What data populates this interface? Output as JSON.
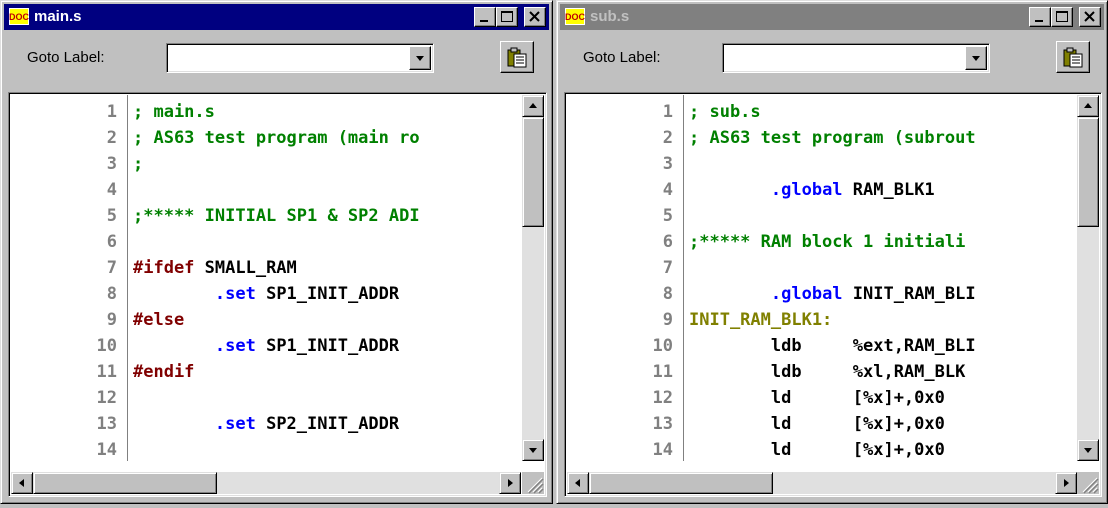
{
  "colors": {
    "comment": "#008000",
    "directive": "#0000ff",
    "preprocessor": "#800000",
    "label": "#808000",
    "normal": "#000000",
    "line_number": "#808080",
    "active_title": "#000080",
    "inactive_title": "#808080"
  },
  "windows": [
    {
      "id": "main",
      "title": "main.s",
      "active": true,
      "icon": "doc-icon",
      "goto_label": "Goto Label:",
      "goto_value": "",
      "lines": [
        {
          "n": "1",
          "text": "; main.s",
          "kind": "comment"
        },
        {
          "n": "2",
          "text": "; AS63 test program (main ro",
          "kind": "comment"
        },
        {
          "n": "3",
          "text": ";",
          "kind": "comment"
        },
        {
          "n": "4",
          "text": "",
          "kind": "normal"
        },
        {
          "n": "5",
          "text": ";***** INITIAL SP1 & SP2 ADI",
          "kind": "comment"
        },
        {
          "n": "6",
          "text": "",
          "kind": "normal"
        },
        {
          "n": "7",
          "segments": [
            {
              "text": "#ifdef",
              "kind": "preprocessor"
            },
            {
              "text": " SMALL_RAM",
              "kind": "normal"
            }
          ]
        },
        {
          "n": "8",
          "segments": [
            {
              "text": "        ",
              "kind": "normal"
            },
            {
              "text": ".set",
              "kind": "directive"
            },
            {
              "text": " SP1_INIT_ADDR",
              "kind": "normal"
            }
          ]
        },
        {
          "n": "9",
          "text": "#else",
          "kind": "preprocessor"
        },
        {
          "n": "10",
          "segments": [
            {
              "text": "        ",
              "kind": "normal"
            },
            {
              "text": ".set",
              "kind": "directive"
            },
            {
              "text": " SP1_INIT_ADDR",
              "kind": "normal"
            }
          ]
        },
        {
          "n": "11",
          "text": "#endif",
          "kind": "preprocessor"
        },
        {
          "n": "12",
          "text": "",
          "kind": "normal"
        },
        {
          "n": "13",
          "segments": [
            {
              "text": "        ",
              "kind": "normal"
            },
            {
              "text": ".set",
              "kind": "directive"
            },
            {
              "text": " SP2_INIT_ADDR",
              "kind": "normal"
            }
          ]
        },
        {
          "n": "14",
          "text": "",
          "kind": "normal"
        }
      ]
    },
    {
      "id": "sub",
      "title": "sub.s",
      "active": false,
      "icon": "doc-icon",
      "goto_label": "Goto Label:",
      "goto_value": "",
      "lines": [
        {
          "n": "1",
          "text": "; sub.s",
          "kind": "comment"
        },
        {
          "n": "2",
          "text": "; AS63 test program (subrout",
          "kind": "comment"
        },
        {
          "n": "3",
          "text": "",
          "kind": "normal"
        },
        {
          "n": "4",
          "segments": [
            {
              "text": "        ",
              "kind": "normal"
            },
            {
              "text": ".global",
              "kind": "directive"
            },
            {
              "text": " RAM_BLK1",
              "kind": "normal"
            }
          ]
        },
        {
          "n": "5",
          "text": "",
          "kind": "normal"
        },
        {
          "n": "6",
          "text": ";***** RAM block 1 initiali",
          "kind": "comment"
        },
        {
          "n": "7",
          "text": "",
          "kind": "normal"
        },
        {
          "n": "8",
          "segments": [
            {
              "text": "        ",
              "kind": "normal"
            },
            {
              "text": ".global",
              "kind": "directive"
            },
            {
              "text": " INIT_RAM_BLI",
              "kind": "normal"
            }
          ]
        },
        {
          "n": "9",
          "text": "INIT_RAM_BLK1:",
          "kind": "label"
        },
        {
          "n": "10",
          "text": "        ldb     %ext,RAM_BLI",
          "kind": "normal"
        },
        {
          "n": "11",
          "text": "        ldb     %xl,RAM_BLK",
          "kind": "normal"
        },
        {
          "n": "12",
          "text": "        ld      [%x]+,0x0",
          "kind": "normal"
        },
        {
          "n": "13",
          "text": "        ld      [%x]+,0x0",
          "kind": "normal"
        },
        {
          "n": "14",
          "text": "        ld      [%x]+,0x0",
          "kind": "normal"
        }
      ]
    }
  ]
}
